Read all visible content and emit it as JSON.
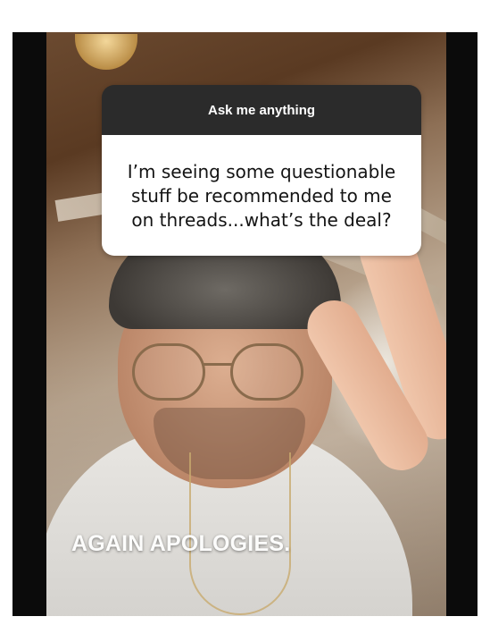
{
  "question_sticker": {
    "header": "Ask me anything",
    "line1": "I’m seeing some questionable",
    "line2": "stuff be recommended to me",
    "line3": "on threads...what’s the deal?"
  },
  "caption": {
    "text": "AGAIN APOLOGIES."
  },
  "colors": {
    "sticker_header_bg": "#2b2b2b",
    "sticker_body_bg": "#ffffff",
    "frame_bg": "#0b0b0b"
  }
}
